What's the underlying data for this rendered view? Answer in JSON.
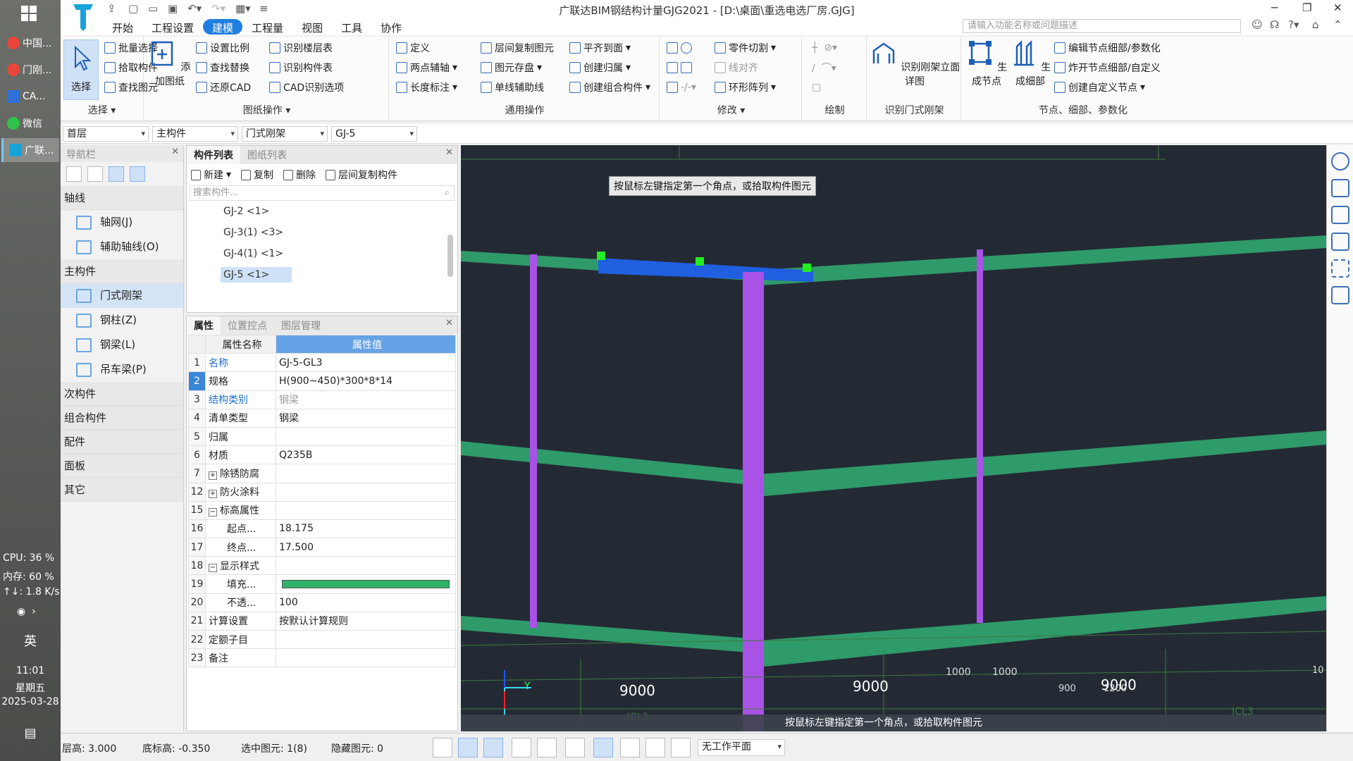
{
  "taskbar": {
    "apps": [
      {
        "label": "中国...",
        "color": "#e8463a"
      },
      {
        "label": "门刚...",
        "color": "#e8463a"
      },
      {
        "label": "CA...",
        "color": "#2f6fd6"
      },
      {
        "label": "微信",
        "color": "#2ec24a"
      },
      {
        "label": "广联...",
        "color": "#17a3d9"
      }
    ],
    "cpu": "CPU: 36 %",
    "mem": "内存: 60 %",
    "net": "↑↓: 1.8 K/s",
    "ime": "英",
    "time": "11:01",
    "weekday": "星期五",
    "date": "2025-03-28"
  },
  "window": {
    "title": "广联达BIM钢结构计量GJG2021 - [D:\\桌面\\重选电选厂房.GJG]",
    "search_placeholder": "请输入功能名称或问题描述",
    "menu": [
      "开始",
      "工程设置",
      "建模",
      "工程量",
      "视图",
      "工具",
      "协作"
    ],
    "active_menu": "建模"
  },
  "ribbon": {
    "groups": [
      "选择",
      "图纸操作",
      "通用操作",
      "修改",
      "绘制",
      "识别门式刚架",
      "节点、细部、参数化"
    ],
    "select": {
      "big": "选择",
      "items": [
        "批量选择",
        "拾取构件",
        "查找图元"
      ]
    },
    "drawing": {
      "big": "添加图纸",
      "col1": [
        "设置比例",
        "查找替换",
        "还原CAD"
      ],
      "col2": [
        "识别楼层表",
        "识别构件表",
        "CAD识别选项"
      ]
    },
    "general": {
      "col1": [
        "定义",
        "两点辅轴",
        "长度标注"
      ],
      "col2": [
        "层间复制图元",
        "图元存盘",
        "单线辅助线"
      ],
      "col3": [
        "平齐到面",
        "创建归属",
        "创建组合构件"
      ]
    },
    "modify": {
      "items": [
        "零件切割",
        "线对齐",
        "环形阵列"
      ]
    },
    "recognize": {
      "big": "识别刚架立面详图"
    },
    "nodes": {
      "big1": "生成节点",
      "big2": "生成细部",
      "items": [
        "编辑节点细部/参数化",
        "炸开节点细部/自定义",
        "创建自定义节点"
      ]
    }
  },
  "filterbar": {
    "floor": "首层",
    "type": "主构件",
    "subtype": "门式刚架",
    "component": "GJ-5"
  },
  "nav": {
    "title": "导航栏",
    "categories": [
      {
        "label": "轴线",
        "items": [
          "轴网(J)",
          "辅助轴线(O)"
        ]
      },
      {
        "label": "主构件",
        "items": [
          "门式刚架",
          "钢柱(Z)",
          "钢梁(L)",
          "吊车梁(P)"
        ]
      },
      {
        "label": "次构件",
        "items": []
      },
      {
        "label": "组合构件",
        "items": []
      },
      {
        "label": "配件",
        "items": []
      },
      {
        "label": "面板",
        "items": []
      },
      {
        "label": "其它",
        "items": []
      }
    ]
  },
  "complist": {
    "tabs": [
      "构件列表",
      "图纸列表"
    ],
    "tools": [
      "新建",
      "复制",
      "删除",
      "层间复制构件"
    ],
    "search_placeholder": "搜索构件...",
    "items": [
      "GJ-2 <1>",
      "GJ-3(1) <3>",
      "GJ-4(1) <1>",
      "GJ-5 <1>"
    ],
    "selected": "GJ-5 <1>"
  },
  "props": {
    "tabs": [
      "属性",
      "位置控点",
      "图层管理"
    ],
    "header": {
      "name": "属性名称",
      "value": "属性值"
    },
    "rows": [
      {
        "no": "1",
        "name": "名称",
        "value": "GJ-5-GL3"
      },
      {
        "no": "2",
        "name": "规格",
        "value": "H(900~450)*300*8*14"
      },
      {
        "no": "3",
        "name": "结构类别",
        "value": "钢梁"
      },
      {
        "no": "4",
        "name": "清单类型",
        "value": "钢梁"
      },
      {
        "no": "5",
        "name": "归属",
        "value": ""
      },
      {
        "no": "6",
        "name": "材质",
        "value": "Q235B"
      },
      {
        "no": "7",
        "name": "除锈防腐",
        "value": ""
      },
      {
        "no": "12",
        "name": "防火涂料",
        "value": ""
      },
      {
        "no": "15",
        "name": "标高属性",
        "value": ""
      },
      {
        "no": "16",
        "name": "起点...",
        "value": "18.175"
      },
      {
        "no": "17",
        "name": "终点...",
        "value": "17.500"
      },
      {
        "no": "18",
        "name": "显示样式",
        "value": ""
      },
      {
        "no": "19",
        "name": "填充...",
        "value": ""
      },
      {
        "no": "20",
        "name": "不透...",
        "value": "100"
      },
      {
        "no": "21",
        "name": "计算设置",
        "value": "按默认计算规则"
      },
      {
        "no": "22",
        "name": "定额子目",
        "value": ""
      },
      {
        "no": "23",
        "name": "备注",
        "value": ""
      }
    ],
    "fill_color": "#2fb36a"
  },
  "viewport": {
    "tooltip": "按鼠标左键指定第一个角点，或拾取构件图元",
    "status": "按鼠标左键指定第一个角点，或拾取构件图元",
    "dims": [
      "9000",
      "9000",
      "9000",
      "1000",
      "1000",
      "900",
      "1200",
      "10"
    ],
    "labels": [
      "JCL1",
      "JCL3"
    ],
    "axis_y": "Y",
    "colors": {
      "beam": "#2f9a6a",
      "column": "#a952e6",
      "selected": "#1f5fe0",
      "grip": "#22ee22"
    }
  },
  "statusbar": {
    "floor_height": "层高: 3.000",
    "base_elev": "底标高: -0.350",
    "selected": "选中图元: 1(8)",
    "hidden": "隐藏图元: 0",
    "workplane": "无工作平面"
  }
}
